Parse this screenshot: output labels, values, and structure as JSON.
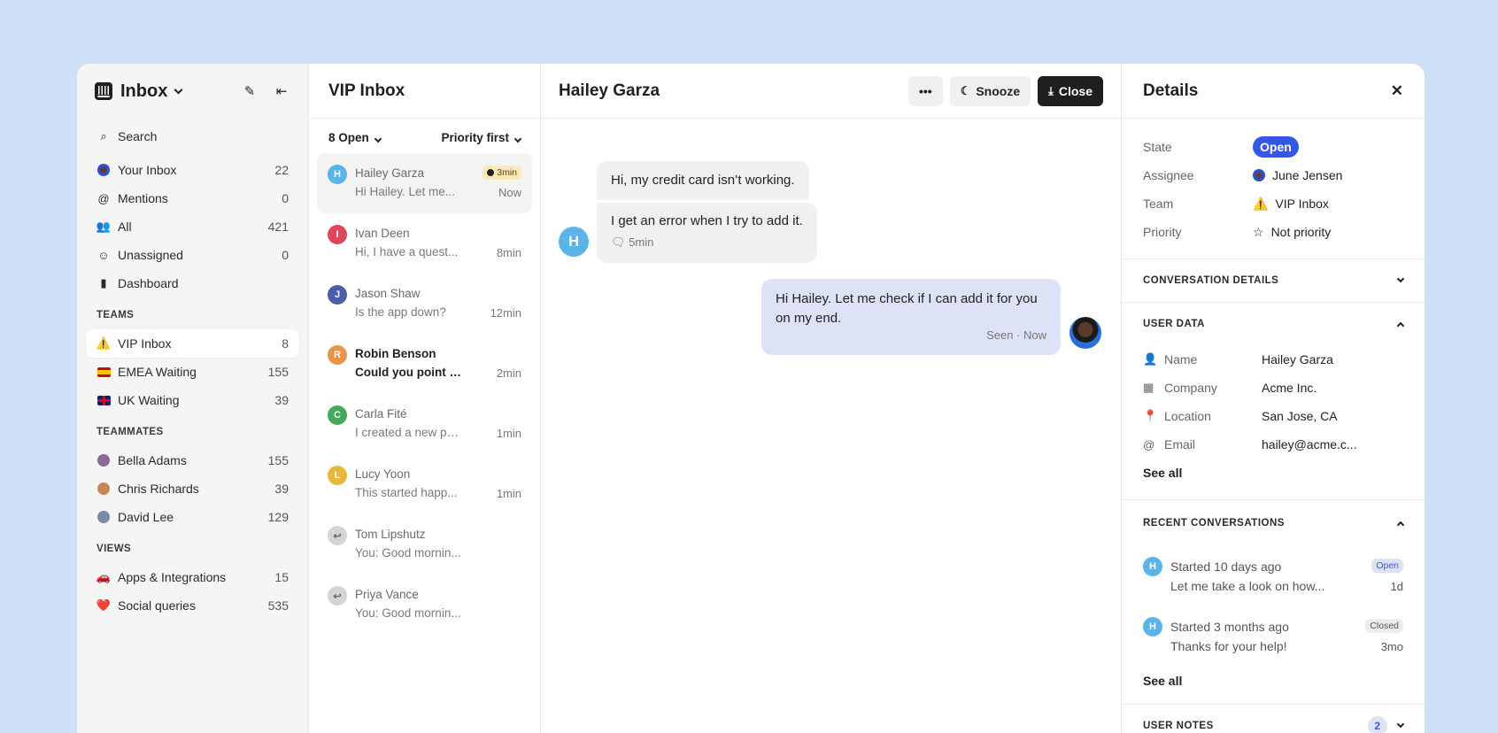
{
  "nav": {
    "title": "Inbox",
    "search": "Search",
    "items": [
      {
        "label": "Your Inbox",
        "count": "22",
        "icon": "avatar"
      },
      {
        "label": "Mentions",
        "count": "0",
        "icon": "at-icon"
      },
      {
        "label": "All",
        "count": "421",
        "icon": "people-icon"
      },
      {
        "label": "Unassigned",
        "count": "0",
        "icon": "unassigned-icon"
      },
      {
        "label": "Dashboard",
        "count": "",
        "icon": "bar-chart-icon"
      }
    ],
    "teams_label": "TEAMS",
    "teams": [
      {
        "label": "VIP Inbox",
        "count": "8",
        "icon": "⚠️"
      },
      {
        "label": "EMEA Waiting",
        "count": "155",
        "icon": "spain-flag"
      },
      {
        "label": "UK Waiting",
        "count": "39",
        "icon": "uk-flag"
      }
    ],
    "teammates_label": "TEAMMATES",
    "teammates": [
      {
        "label": "Bella Adams",
        "count": "155"
      },
      {
        "label": "Chris Richards",
        "count": "39"
      },
      {
        "label": "David Lee",
        "count": "129"
      }
    ],
    "views_label": "VIEWS",
    "views": [
      {
        "label": "Apps & Integrations",
        "count": "15",
        "icon": "🚗"
      },
      {
        "label": "Social queries",
        "count": "535",
        "icon": "❤️"
      }
    ]
  },
  "list": {
    "title": "VIP Inbox",
    "filter_open": "8 Open",
    "filter_sort": "Priority first",
    "conversations": [
      {
        "initial": "H",
        "name": "Hailey Garza",
        "preview": "Hi Hailey. Let me...",
        "time": "Now",
        "badge": "3min",
        "color": "#5bb4e8"
      },
      {
        "initial": "I",
        "name": "Ivan Deen",
        "preview": "Hi, I have a quest...",
        "time": "8min",
        "color": "#e0455a"
      },
      {
        "initial": "J",
        "name": "Jason Shaw",
        "preview": "Is the app down?",
        "time": "12min",
        "color": "#4a5fa8"
      },
      {
        "initial": "R",
        "name": "Robin Benson",
        "preview": "Could you point m...",
        "time": "2min",
        "color": "#e8954a"
      },
      {
        "initial": "C",
        "name": "Carla Fité",
        "preview": "I created a new page...",
        "time": "1min",
        "color": "#45a85a"
      },
      {
        "initial": "L",
        "name": "Lucy Yoon",
        "preview": "This started happ...",
        "time": "1min",
        "color": "#e8b83a"
      },
      {
        "initial": "↩",
        "name": "Tom Lipshutz",
        "preview": "You: Good mornin...",
        "time": "",
        "color": "#d4d4d4"
      },
      {
        "initial": "↩",
        "name": "Priya Vance",
        "preview": "You: Good mornin...",
        "time": "",
        "color": "#d4d4d4"
      }
    ]
  },
  "chat": {
    "title": "Hailey Garza",
    "snooze": "Snooze",
    "close": "Close",
    "msg1": "Hi, my credit card isn’t working.",
    "msg2": "I get an error when I try to add it.",
    "msg2_time": "5min",
    "avatar_initial": "H",
    "reply": "Hi Hailey. Let me check if I can add it for you on my end.",
    "reply_meta": "Seen · Now"
  },
  "details": {
    "title": "Details",
    "state_label": "State",
    "state_value": "Open",
    "assignee_label": "Assignee",
    "assignee_value": "June Jensen",
    "team_label": "Team",
    "team_value": "VIP Inbox",
    "priority_label": "Priority",
    "priority_value": "Not priority",
    "conv_details": "CONVERSATION DETAILS",
    "user_data": "USER DATA",
    "user_fields": [
      {
        "label": "Name",
        "value": "Hailey Garza"
      },
      {
        "label": "Company",
        "value": "Acme Inc."
      },
      {
        "label": "Location",
        "value": "San Jose, CA"
      },
      {
        "label": "Email",
        "value": "hailey@acme.c..."
      }
    ],
    "see_all": "See all",
    "recent_conv": "RECENT CONVERSATIONS",
    "recent": [
      {
        "initial": "H",
        "title": "Started 10 days ago",
        "preview": "Let me take a look on how...",
        "tag": "Open",
        "time": "1d"
      },
      {
        "initial": "H",
        "title": "Started 3 months ago",
        "preview": "Thanks for your help!",
        "tag": "Closed",
        "time": "3mo"
      }
    ],
    "see_all_2": "See all",
    "user_notes": "USER NOTES",
    "notes_count": "2"
  }
}
